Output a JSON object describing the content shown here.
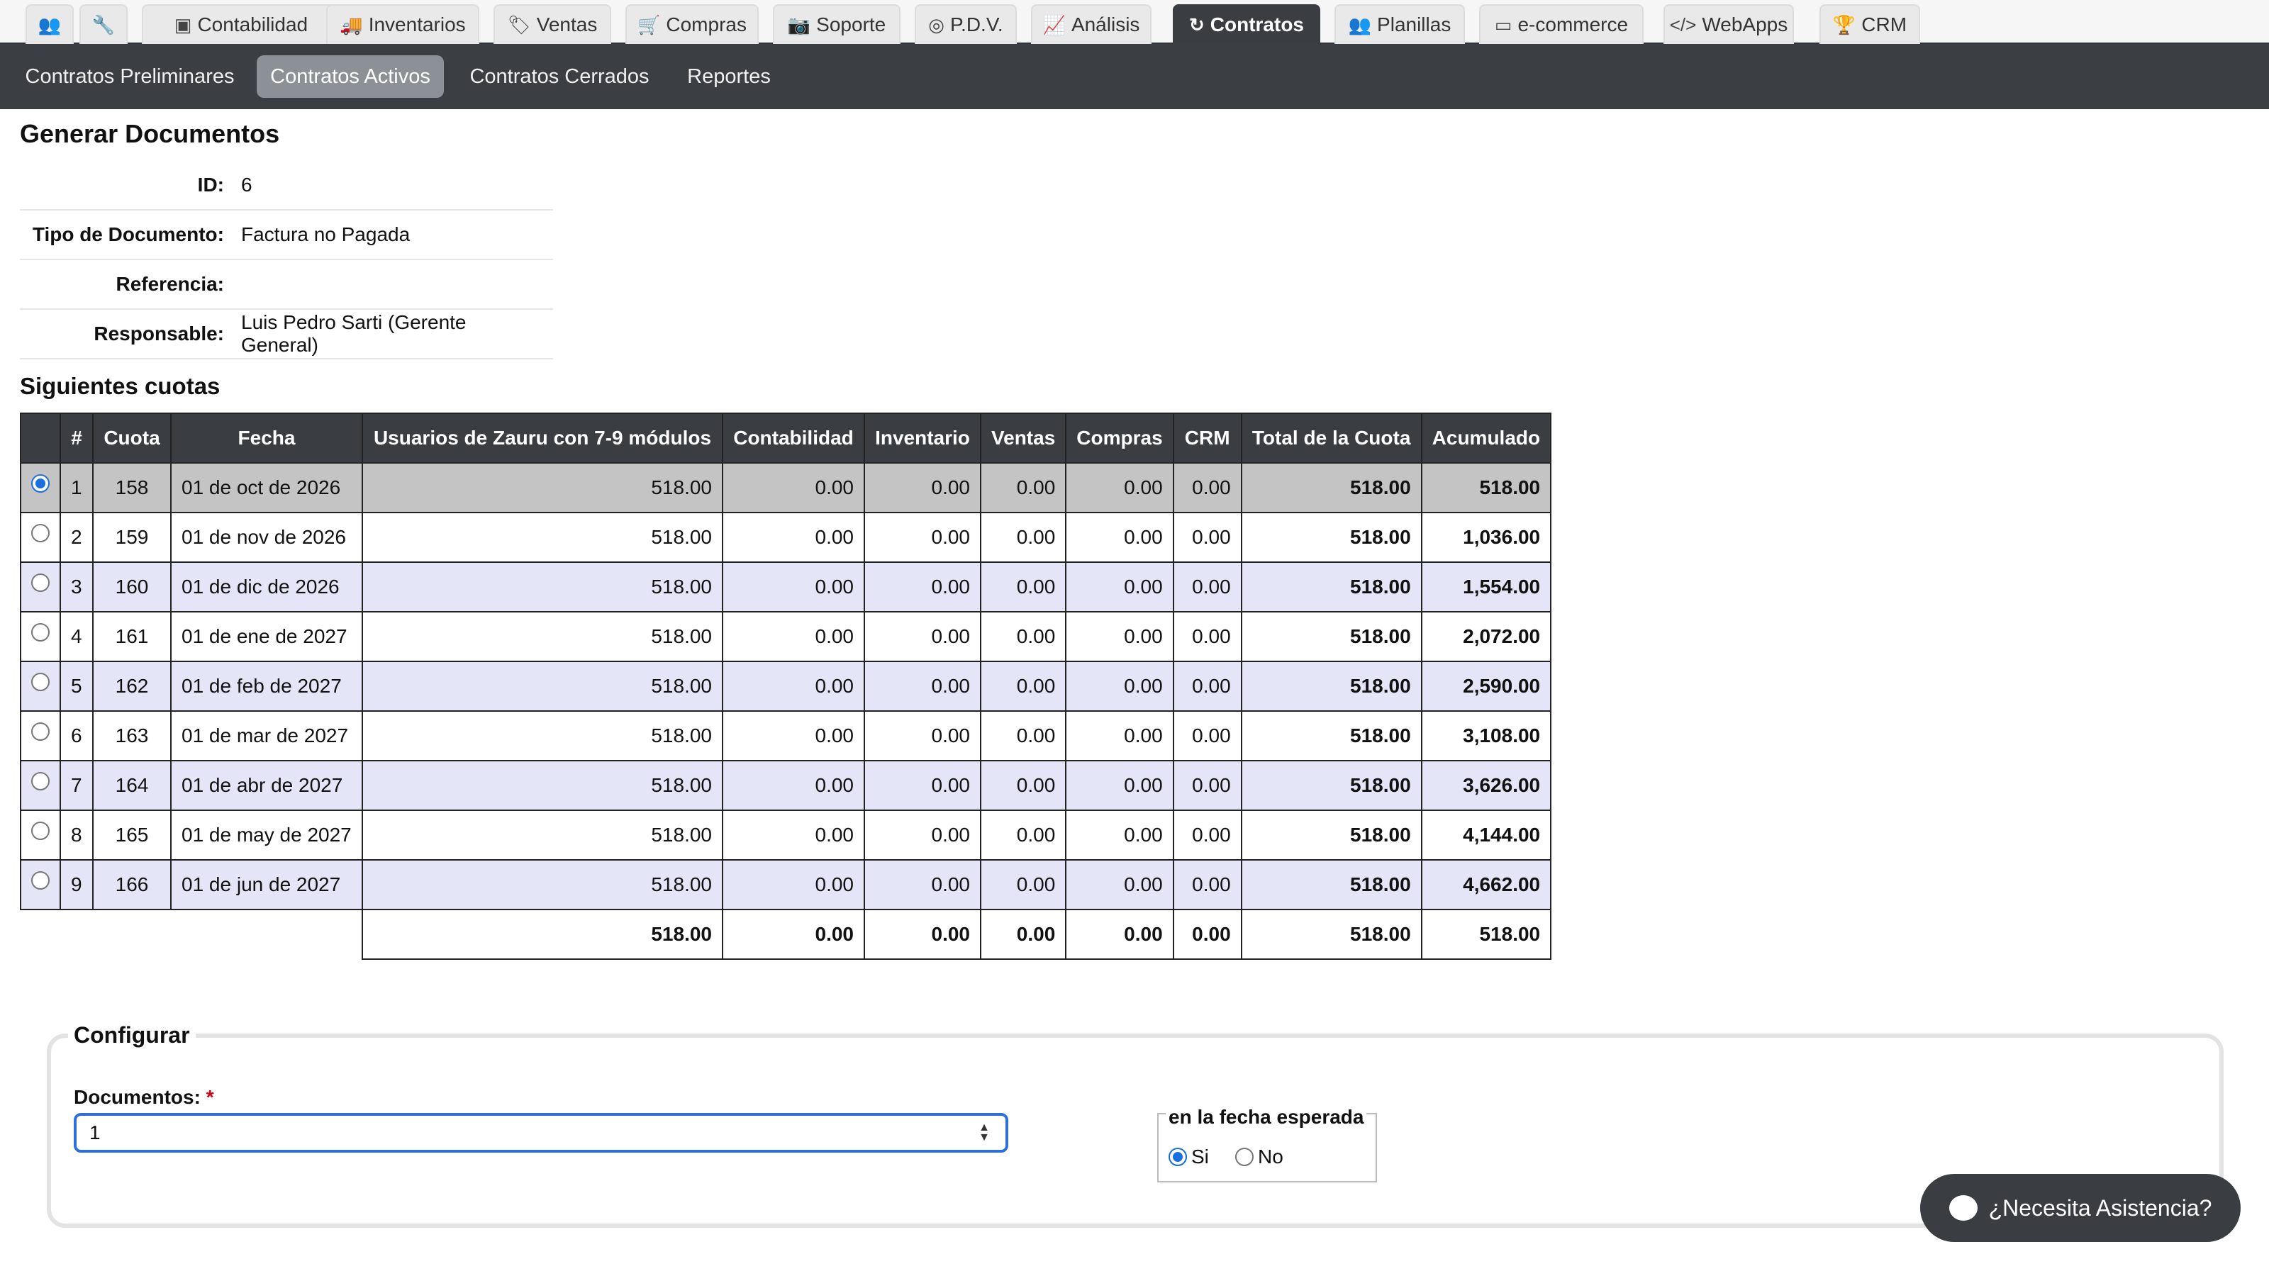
{
  "top_tabs": [
    {
      "label": "",
      "icon": "users-icon"
    },
    {
      "label": "",
      "icon": "wrench-icon"
    },
    {
      "label": "Contabilidad",
      "icon": "money-icon"
    },
    {
      "label": "Inventarios",
      "icon": "truck-icon"
    },
    {
      "label": "Ventas",
      "icon": "tags-icon"
    },
    {
      "label": "Compras",
      "icon": "cart-icon"
    },
    {
      "label": "Soporte",
      "icon": "camera-icon"
    },
    {
      "label": "P.D.V.",
      "icon": "target-icon"
    },
    {
      "label": "Análisis",
      "icon": "chart-icon"
    },
    {
      "label": "Contratos",
      "icon": "refresh-icon"
    },
    {
      "label": "Planillas",
      "icon": "users-icon"
    },
    {
      "label": "e-commerce",
      "icon": "card-icon"
    },
    {
      "label": "WebApps",
      "icon": "code-icon"
    },
    {
      "label": "CRM",
      "icon": "trophy-icon"
    }
  ],
  "active_tab": "Contratos",
  "sub_nav": [
    "Contratos Preliminares",
    "Contratos Activos",
    "Contratos Cerrados",
    "Reportes"
  ],
  "active_sub": "Contratos Activos",
  "page_title": "Generar Documentos",
  "info": [
    {
      "label": "ID:",
      "value": "6"
    },
    {
      "label": "Tipo de Documento:",
      "value": "Factura no Pagada"
    },
    {
      "label": "Referencia:",
      "value": ""
    },
    {
      "label": "Responsable:",
      "value": "Luis Pedro Sarti (Gerente General)"
    }
  ],
  "section_title": "Siguientes cuotas",
  "table": {
    "headers": [
      "",
      "#",
      "Cuota",
      "Fecha",
      "Usuarios de Zauru con 7-9 módulos",
      "Contabilidad",
      "Inventario",
      "Ventas",
      "Compras",
      "CRM",
      "Total de la Cuota",
      "Acumulado"
    ],
    "rows": [
      [
        "1",
        "158",
        "01 de oct de 2026",
        "518.00",
        "0.00",
        "0.00",
        "0.00",
        "0.00",
        "0.00",
        "518.00",
        "518.00"
      ],
      [
        "2",
        "159",
        "01 de nov de 2026",
        "518.00",
        "0.00",
        "0.00",
        "0.00",
        "0.00",
        "0.00",
        "518.00",
        "1,036.00"
      ],
      [
        "3",
        "160",
        "01 de dic de 2026",
        "518.00",
        "0.00",
        "0.00",
        "0.00",
        "0.00",
        "0.00",
        "518.00",
        "1,554.00"
      ],
      [
        "4",
        "161",
        "01 de ene de 2027",
        "518.00",
        "0.00",
        "0.00",
        "0.00",
        "0.00",
        "0.00",
        "518.00",
        "2,072.00"
      ],
      [
        "5",
        "162",
        "01 de feb de 2027",
        "518.00",
        "0.00",
        "0.00",
        "0.00",
        "0.00",
        "0.00",
        "518.00",
        "2,590.00"
      ],
      [
        "6",
        "163",
        "01 de mar de 2027",
        "518.00",
        "0.00",
        "0.00",
        "0.00",
        "0.00",
        "0.00",
        "518.00",
        "3,108.00"
      ],
      [
        "7",
        "164",
        "01 de abr de 2027",
        "518.00",
        "0.00",
        "0.00",
        "0.00",
        "0.00",
        "0.00",
        "518.00",
        "3,626.00"
      ],
      [
        "8",
        "165",
        "01 de may de 2027",
        "518.00",
        "0.00",
        "0.00",
        "0.00",
        "0.00",
        "0.00",
        "518.00",
        "4,144.00"
      ],
      [
        "9",
        "166",
        "01 de jun de 2027",
        "518.00",
        "0.00",
        "0.00",
        "0.00",
        "0.00",
        "0.00",
        "518.00",
        "4,662.00"
      ]
    ],
    "selected_row": 0,
    "totals": [
      "518.00",
      "0.00",
      "0.00",
      "0.00",
      "0.00",
      "0.00",
      "518.00",
      "518.00"
    ]
  },
  "config": {
    "legend": "Configurar",
    "documents_label": "Documentos:",
    "required_mark": "*",
    "documents_value": "1",
    "expected_date_legend": "en la fecha esperada",
    "options": [
      "Si",
      "No"
    ],
    "selected_option": "Si"
  },
  "help_button": "¿Necesita Asistencia?"
}
